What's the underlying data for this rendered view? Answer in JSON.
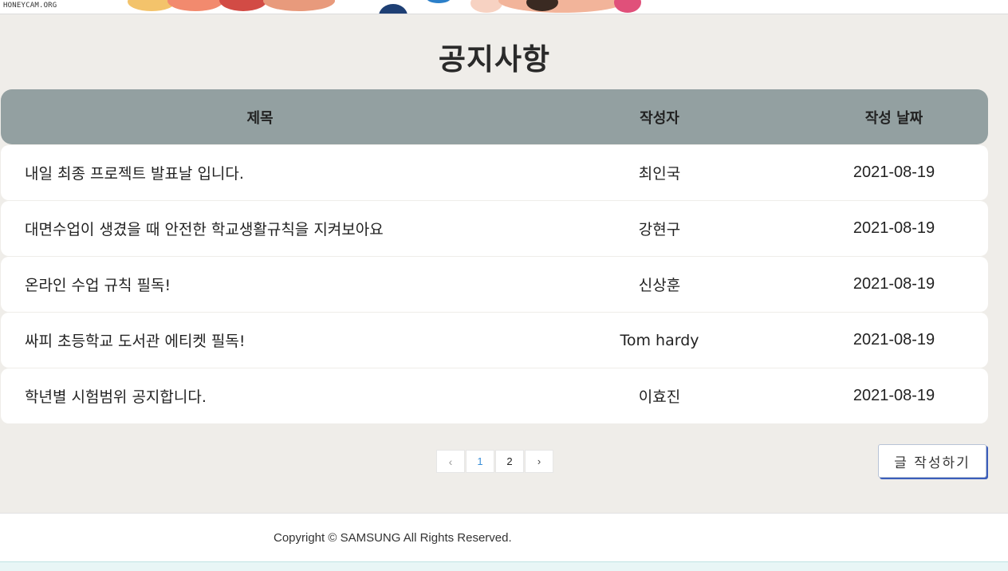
{
  "watermark": "HONEYCAM.ORG",
  "notice": {
    "page_title": "공지사항",
    "columns": {
      "title": "제목",
      "author": "작성자",
      "date": "작성 날짜"
    },
    "rows": [
      {
        "title": "내일 최종 프로젝트 발표날 입니다.",
        "author": "최인국",
        "date": "2021-08-19"
      },
      {
        "title": "대면수업이 생겼을 때 안전한 학교생활규칙을 지켜보아요",
        "author": "강현구",
        "date": "2021-08-19"
      },
      {
        "title": "온라인 수업 규칙 필독!",
        "author": "신상훈",
        "date": "2021-08-19"
      },
      {
        "title": "싸피 초등학교 도서관 에티켓 필독!",
        "author": "Tom hardy",
        "date": "2021-08-19"
      },
      {
        "title": "학년별 시험범위 공지합니다.",
        "author": "이효진",
        "date": "2021-08-19"
      }
    ]
  },
  "pagination": {
    "prev_icon": "chevron-left-icon",
    "next_icon": "chevron-right-icon",
    "prev_glyph": "‹",
    "next_glyph": "›",
    "pages": [
      "1",
      "2"
    ],
    "active_page": "1"
  },
  "write_button": {
    "label": "글 작성하기"
  },
  "footer": {
    "copyright": "Copyright © SAMSUNG All Rights Reserved."
  },
  "colors": {
    "background": "#efede9",
    "table_header": "#93a0a1",
    "active_page": "#3a8fd8",
    "button_shadow": "#3b5dbb"
  }
}
